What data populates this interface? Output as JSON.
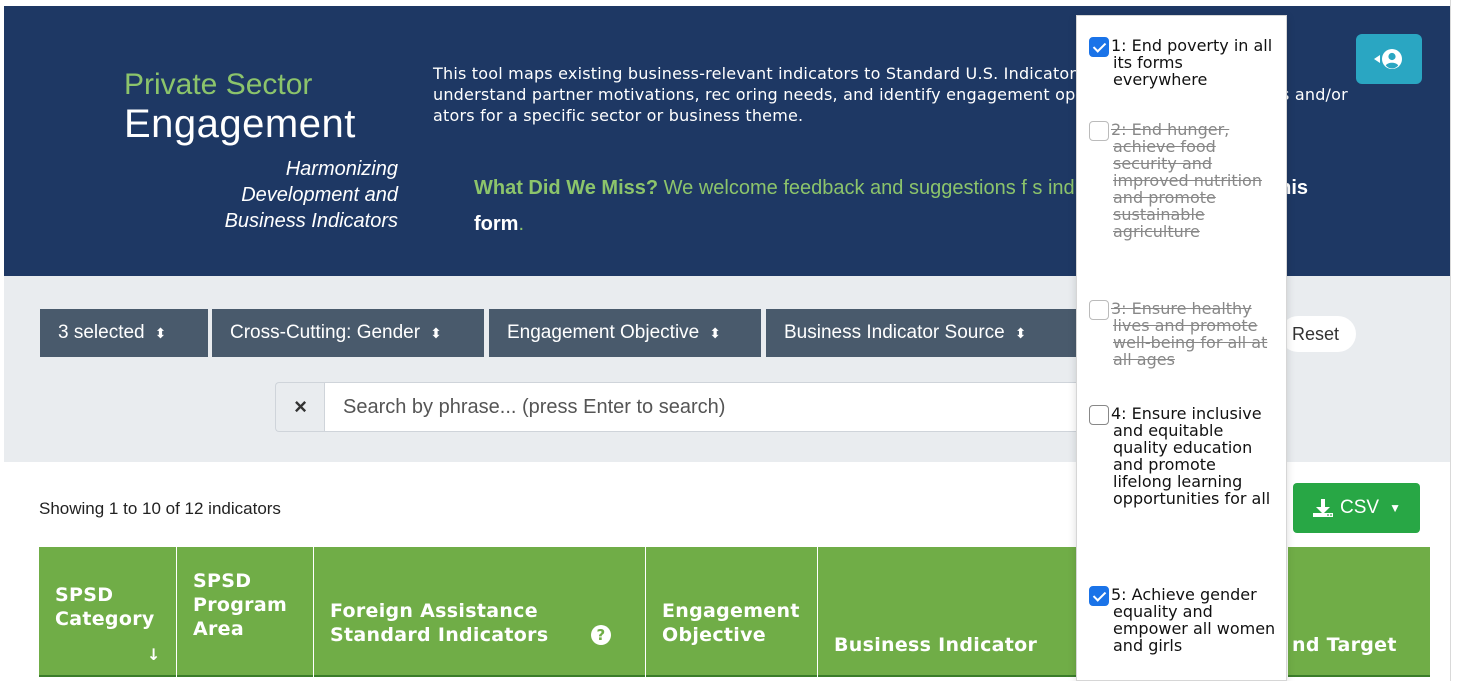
{
  "header": {
    "brand_line1": "Private Sector",
    "brand_line2": "Engagement",
    "tagline": "Harmonizing Development and Business Indicators",
    "intro": "This tool maps existing business-relevant indicators to Standard U.S. Indicators. Use the tool to better understand partner motivations, rec oring needs, and identify engagement opportunities. Use the filters and/or ators for a specific sector or business theme.",
    "feedback_lead": "What Did We Miss?",
    "feedback_text": " We welcome feedback and suggestions f s indicator linkages, ",
    "feedback_link": "using this form",
    "feedback_end": "."
  },
  "filters": [
    {
      "label": "3 selected"
    },
    {
      "label": "Cross-Cutting: Gender"
    },
    {
      "label": "Engagement Objective"
    },
    {
      "label": "Business Indicator Source"
    }
  ],
  "reset_label": "Reset",
  "search": {
    "placeholder": "Search by phrase... (press Enter to search)",
    "clear": "×"
  },
  "showing_text": "Showing 1 to 10 of 12 indicators",
  "csv_label": "CSV",
  "columns": [
    "SPSD Category",
    "SPSD Program Area",
    "Foreign Assistance Standard Indicators",
    "Engagement Objective",
    "Business Indicator",
    "nd Target"
  ],
  "sort_indicator": "↓",
  "dropdown": [
    {
      "label": "1: End poverty in all its forms everywhere",
      "checked": true,
      "disabled": false
    },
    {
      "label": "2: End hunger, achieve food security and improved nutrition and promote sustainable agriculture",
      "checked": false,
      "disabled": true
    },
    {
      "label": "3: Ensure healthy lives and promote well-being for all at all ages",
      "checked": false,
      "disabled": true
    },
    {
      "label": "4: Ensure inclusive and equitable quality education and promote lifelong learning opportunities for all",
      "checked": false,
      "disabled": false
    },
    {
      "label": "5: Achieve gender equality and empower all women and girls",
      "checked": true,
      "disabled": false
    }
  ],
  "colors": {
    "header_bg": "#1e3864",
    "brand_green": "#8cc46b",
    "table_head": "#70ad47",
    "filter_bg": "#495a6c",
    "csv_green": "#28a745",
    "login_teal": "#2aa6c2"
  }
}
